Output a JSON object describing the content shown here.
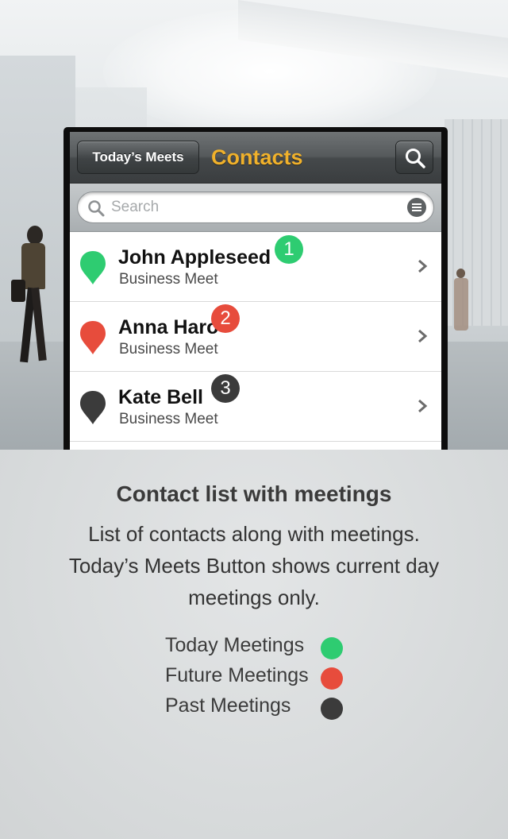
{
  "colors": {
    "today": "#2ecc71",
    "future": "#e74c3c",
    "past": "#3b3b3b",
    "title_accent": "#f0b12b"
  },
  "navbar": {
    "todays_meets_label": "Today’s Meets",
    "title": "Contacts",
    "search_icon": "search-icon"
  },
  "search": {
    "placeholder": "Search",
    "list_icon": "list-icon"
  },
  "contacts": [
    {
      "name": "John Appleseed",
      "subtitle": "Business Meet",
      "badge": "1",
      "status": "today"
    },
    {
      "name": "Anna Haro",
      "subtitle": "Business Meet",
      "badge": "2",
      "status": "future"
    },
    {
      "name": "Kate Bell",
      "subtitle": "Business Meet",
      "badge": "3",
      "status": "past"
    }
  ],
  "description": {
    "heading": "Contact list with meetings",
    "body": "List of contacts along with meetings. Today’s Meets Button shows current day meetings only."
  },
  "legend": [
    {
      "label": "Today Meetings",
      "status": "today"
    },
    {
      "label": "Future Meetings",
      "status": "future"
    },
    {
      "label": "Past Meetings",
      "status": "past"
    }
  ]
}
